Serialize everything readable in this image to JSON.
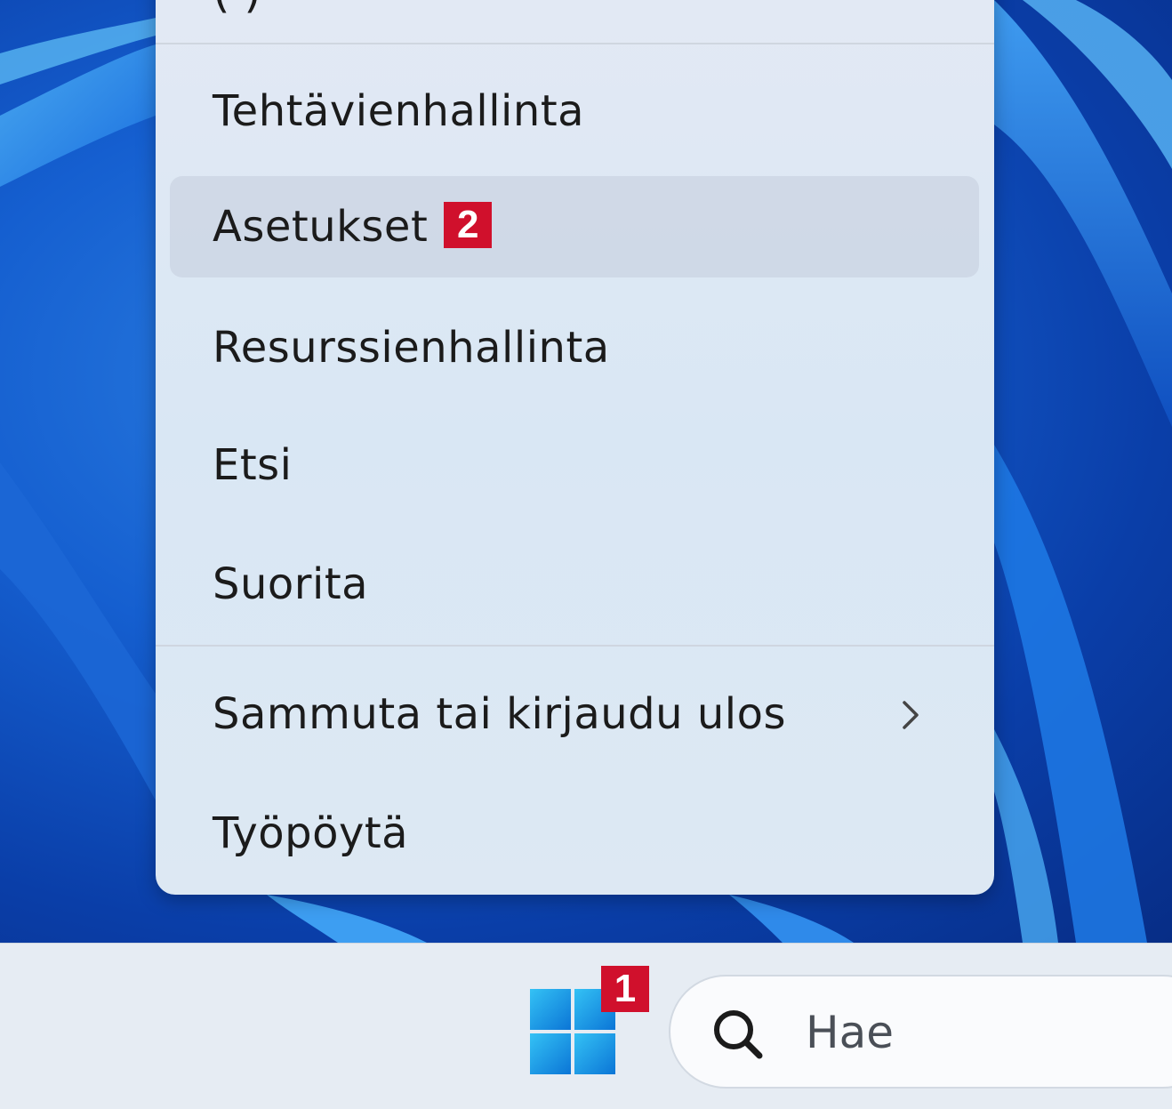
{
  "context_menu": {
    "partial_top_item": "(         )",
    "items": [
      {
        "label": "Tehtävienhallinta"
      },
      {
        "label": "Asetukset",
        "badge": "2"
      },
      {
        "label": "Resurssienhallinta"
      },
      {
        "label": "Etsi"
      },
      {
        "label": "Suorita"
      },
      {
        "label": "Sammuta tai kirjaudu ulos",
        "submenu_icon": "chevron-right-icon"
      },
      {
        "label": "Työpöytä"
      }
    ]
  },
  "taskbar": {
    "start_badge": "1",
    "start_icon": "windows-logo-icon",
    "search": {
      "placeholder": "Hae",
      "icon": "search-icon"
    }
  },
  "colors": {
    "badge": "#d0102c",
    "menu_background": "#dde8f3",
    "taskbar": "#e6ecf3",
    "windows_logo": "#1aa0e8"
  }
}
